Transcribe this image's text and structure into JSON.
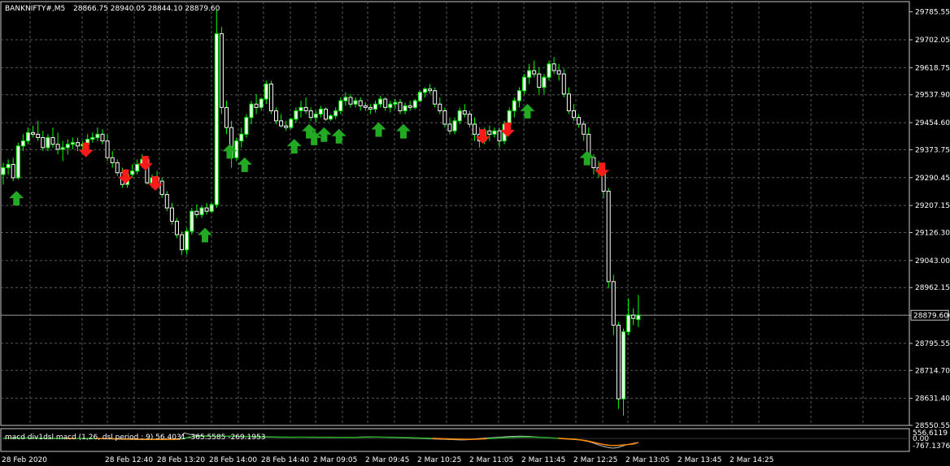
{
  "header": {
    "symbol": "BANKNIFTY#,M5",
    "ohlc": "28866.75 28940.05 28844.10 28879.60"
  },
  "current_price_label": "28879.60",
  "indicator": {
    "label": "macd div1dsl macd (1,26, dsl period ; 9) 56.4031 -365.5585 -269.1953",
    "axis_labels": [
      "556.6119",
      "0.00",
      "-767.1376"
    ]
  },
  "colors": {
    "background": "#000000",
    "bull_candle": "#ffffff",
    "candle_outline": "#00ff00",
    "up_arrow": "#22aa22",
    "down_arrow": "#ff1a1a",
    "grid": "#5a5a5a",
    "text": "#ffffff",
    "macd_line": "#c0c0c0",
    "macd_pos": "#22aa22",
    "macd_neg": "#ff8c00"
  },
  "chart_data": {
    "type": "candlestick",
    "ylim": [
      28550.55,
      29816.0
    ],
    "y_ticks": [
      "29785.55",
      "29702.05",
      "29618.75",
      "29537.90",
      "29454.60",
      "29373.75",
      "29290.45",
      "29207.15",
      "29126.30",
      "29043.00",
      "28962.15",
      "28879.60",
      "28795.55",
      "28714.70",
      "28631.40",
      "28550.55"
    ],
    "x_ticks": [
      "28 Feb 2020",
      "28 Feb 12:40",
      "28 Feb 13:20",
      "28 Feb 14:00",
      "28 Feb 14:40",
      "2 Mar 09:05",
      "2 Mar 09:45",
      "2 Mar 10:25",
      "2 Mar 11:05",
      "2 Mar 11:45",
      "2 Mar 12:25",
      "2 Mar 13:05",
      "2 Mar 13:45",
      "2 Mar 14:25"
    ],
    "current_price": 28879.6,
    "candles": [
      [
        29300,
        29335,
        29270,
        29320
      ],
      [
        29320,
        29345,
        29300,
        29330
      ],
      [
        29330,
        29350,
        29280,
        29290
      ],
      [
        29290,
        29395,
        29285,
        29385
      ],
      [
        29385,
        29420,
        29370,
        29400
      ],
      [
        29400,
        29440,
        29390,
        29425
      ],
      [
        29425,
        29445,
        29410,
        29420
      ],
      [
        29420,
        29460,
        29400,
        29410
      ],
      [
        29410,
        29430,
        29370,
        29380
      ],
      [
        29380,
        29420,
        29370,
        29410
      ],
      [
        29410,
        29440,
        29380,
        29390
      ],
      [
        29390,
        29425,
        29360,
        29375
      ],
      [
        29375,
        29400,
        29340,
        29380
      ],
      [
        29380,
        29405,
        29360,
        29390
      ],
      [
        29390,
        29410,
        29375,
        29395
      ],
      [
        29395,
        29410,
        29370,
        29385
      ],
      [
        29385,
        29400,
        29370,
        29390
      ],
      [
        29390,
        29420,
        29380,
        29405
      ],
      [
        29405,
        29425,
        29395,
        29410
      ],
      [
        29410,
        29440,
        29400,
        29420
      ],
      [
        29420,
        29435,
        29390,
        29400
      ],
      [
        29400,
        29420,
        29340,
        29350
      ],
      [
        29350,
        29370,
        29320,
        29335
      ],
      [
        29335,
        29345,
        29295,
        29305
      ],
      [
        29305,
        29320,
        29260,
        29270
      ],
      [
        29270,
        29310,
        29260,
        29300
      ],
      [
        29300,
        29330,
        29290,
        29310
      ],
      [
        29310,
        29345,
        29300,
        29330
      ],
      [
        29330,
        29360,
        29320,
        29345
      ],
      [
        29345,
        29355,
        29270,
        29275
      ],
      [
        29275,
        29300,
        29260,
        29290
      ],
      [
        29290,
        29310,
        29270,
        29280
      ],
      [
        29280,
        29290,
        29230,
        29240
      ],
      [
        29240,
        29250,
        29190,
        29200
      ],
      [
        29200,
        29215,
        29150,
        29160
      ],
      [
        29160,
        29170,
        29110,
        29120
      ],
      [
        29120,
        29130,
        29060,
        29075
      ],
      [
        29075,
        29140,
        29060,
        29130
      ],
      [
        29130,
        29200,
        29120,
        29190
      ],
      [
        29190,
        29210,
        29170,
        29180
      ],
      [
        29180,
        29205,
        29170,
        29200
      ],
      [
        29200,
        29215,
        29180,
        29190
      ],
      [
        29190,
        29215,
        29185,
        29210
      ],
      [
        29210,
        29790,
        29200,
        29720
      ],
      [
        29720,
        29740,
        29480,
        29500
      ],
      [
        29500,
        29520,
        29420,
        29440
      ],
      [
        29440,
        29460,
        29320,
        29350
      ],
      [
        29350,
        29410,
        29340,
        29400
      ],
      [
        29400,
        29440,
        29380,
        29420
      ],
      [
        29420,
        29480,
        29410,
        29470
      ],
      [
        29470,
        29520,
        29450,
        29510
      ],
      [
        29510,
        29540,
        29480,
        29500
      ],
      [
        29500,
        29530,
        29490,
        29525
      ],
      [
        29525,
        29580,
        29510,
        29570
      ],
      [
        29570,
        29580,
        29480,
        29490
      ],
      [
        29490,
        29500,
        29450,
        29460
      ],
      [
        29460,
        29480,
        29440,
        29445
      ],
      [
        29445,
        29460,
        29430,
        29440
      ],
      [
        29440,
        29470,
        29435,
        29465
      ],
      [
        29465,
        29500,
        29455,
        29490
      ],
      [
        29490,
        29520,
        29470,
        29500
      ],
      [
        29500,
        29530,
        29480,
        29490
      ],
      [
        29490,
        29500,
        29460,
        29470
      ],
      [
        29470,
        29490,
        29455,
        29480
      ],
      [
        29480,
        29505,
        29470,
        29495
      ],
      [
        29495,
        29500,
        29460,
        29465
      ],
      [
        29465,
        29480,
        29460,
        29475
      ],
      [
        29475,
        29500,
        29465,
        29490
      ],
      [
        29490,
        29530,
        29480,
        29520
      ],
      [
        29520,
        29545,
        29505,
        29530
      ],
      [
        29530,
        29540,
        29500,
        29510
      ],
      [
        29510,
        29530,
        29500,
        29520
      ],
      [
        29520,
        29530,
        29490,
        29505
      ],
      [
        29505,
        29515,
        29490,
        29500
      ],
      [
        29500,
        29510,
        29480,
        29495
      ],
      [
        29495,
        29520,
        29485,
        29510
      ],
      [
        29510,
        29535,
        29500,
        29525
      ],
      [
        29525,
        29530,
        29490,
        29500
      ],
      [
        29500,
        29520,
        29485,
        29510
      ],
      [
        29510,
        29525,
        29495,
        29515
      ],
      [
        29515,
        29525,
        29480,
        29490
      ],
      [
        29490,
        29515,
        29480,
        29505
      ],
      [
        29505,
        29520,
        29490,
        29500
      ],
      [
        29500,
        29525,
        29495,
        29520
      ],
      [
        29520,
        29550,
        29515,
        29545
      ],
      [
        29545,
        29560,
        29530,
        29555
      ],
      [
        29555,
        29570,
        29540,
        29550
      ],
      [
        29550,
        29560,
        29500,
        29510
      ],
      [
        29510,
        29530,
        29480,
        29490
      ],
      [
        29490,
        29500,
        29440,
        29450
      ],
      [
        29450,
        29470,
        29420,
        29430
      ],
      [
        29430,
        29470,
        29420,
        29460
      ],
      [
        29460,
        29500,
        29450,
        29490
      ],
      [
        29490,
        29510,
        29470,
        29480
      ],
      [
        29480,
        29490,
        29440,
        29450
      ],
      [
        29450,
        29470,
        29400,
        29420
      ],
      [
        29420,
        29440,
        29380,
        29400
      ],
      [
        29400,
        29440,
        29390,
        29430
      ],
      [
        29430,
        29445,
        29400,
        29420
      ],
      [
        29420,
        29440,
        29410,
        29430
      ],
      [
        29430,
        29440,
        29380,
        29400
      ],
      [
        29400,
        29460,
        29390,
        29450
      ],
      [
        29450,
        29500,
        29440,
        29490
      ],
      [
        29490,
        29530,
        29470,
        29520
      ],
      [
        29520,
        29560,
        29500,
        29550
      ],
      [
        29550,
        29600,
        29540,
        29590
      ],
      [
        29590,
        29630,
        29570,
        29610
      ],
      [
        29610,
        29640,
        29590,
        29600
      ],
      [
        29600,
        29620,
        29540,
        29560
      ],
      [
        29560,
        29600,
        29540,
        29590
      ],
      [
        29590,
        29640,
        29580,
        29630
      ],
      [
        29630,
        29650,
        29600,
        29610
      ],
      [
        29610,
        29630,
        29580,
        29600
      ],
      [
        29600,
        29615,
        29530,
        29540
      ],
      [
        29540,
        29560,
        29480,
        29490
      ],
      [
        29490,
        29510,
        29460,
        29470
      ],
      [
        29470,
        29480,
        29440,
        29450
      ],
      [
        29450,
        29460,
        29400,
        29420
      ],
      [
        29420,
        29440,
        29330,
        29350
      ],
      [
        29350,
        29360,
        29300,
        29320
      ],
      [
        29320,
        29340,
        29290,
        29310
      ],
      [
        29310,
        29320,
        29230,
        29250
      ],
      [
        29250,
        29260,
        28960,
        28980
      ],
      [
        28980,
        29000,
        28820,
        28850
      ],
      [
        28850,
        28860,
        28600,
        28630
      ],
      [
        28630,
        28840,
        28580,
        28830
      ],
      [
        28830,
        28930,
        28820,
        28880
      ],
      [
        28880,
        28900,
        28850,
        28870
      ],
      [
        28866.75,
        28940.05,
        28844.1,
        28879.6
      ]
    ],
    "up_signals": [
      2,
      40,
      45,
      48,
      58,
      61,
      62,
      64,
      67,
      75,
      80,
      105,
      117,
      130,
      134
    ],
    "down_signals": [
      16,
      24,
      28,
      30,
      96,
      101,
      120,
      129,
      148
    ],
    "macd": {
      "ylim": [
        -767.1376,
        556.6119
      ],
      "values": [
        20,
        30,
        35,
        40,
        42,
        38,
        30,
        22,
        15,
        10,
        5,
        0,
        -5,
        -10,
        -12,
        -8,
        -4,
        0,
        5,
        8,
        6,
        2,
        -5,
        -12,
        -20,
        -28,
        -36,
        -44,
        -50,
        -56,
        -60,
        -64,
        -68,
        -72,
        -76,
        -80,
        -78,
        -70,
        -60,
        -50,
        -40,
        -30,
        -20,
        380,
        300,
        250,
        210,
        190,
        180,
        170,
        165,
        160,
        158,
        156,
        150,
        140,
        130,
        120,
        112,
        108,
        105,
        100,
        95,
        90,
        86,
        82,
        80,
        78,
        80,
        84,
        88,
        90,
        88,
        84,
        80,
        76,
        74,
        72,
        70,
        70,
        72,
        74,
        76,
        80,
        90,
        100,
        110,
        115,
        110,
        100,
        90,
        80,
        70,
        60,
        50,
        40,
        30,
        20,
        10,
        0,
        -10,
        -20,
        -30,
        -40,
        -50,
        -60,
        -70,
        -80,
        -90,
        -100,
        -90,
        -70,
        -40,
        -10,
        10,
        30,
        50,
        70,
        90,
        110,
        130,
        140,
        150,
        155,
        150,
        140,
        120,
        100,
        80,
        60,
        40,
        20,
        0,
        -20,
        -40,
        -60,
        -80,
        -100,
        -150,
        -200,
        -280,
        -380,
        -480,
        -560,
        -620,
        -660,
        -620,
        -540,
        -440,
        -380,
        -320,
        -280
      ],
      "signal": [
        15,
        22,
        28,
        33,
        36,
        36,
        34,
        30,
        26,
        21,
        17,
        13,
        9,
        5,
        2,
        0,
        -1,
        -1,
        0,
        2,
        3,
        3,
        1,
        -2,
        -6,
        -11,
        -16,
        -22,
        -28,
        -34,
        -39,
        -44,
        -49,
        -54,
        -58,
        -63,
        -66,
        -67,
        -66,
        -63,
        -59,
        -54,
        -48,
        20,
        76,
        110,
        130,
        142,
        150,
        154,
        156,
        157,
        157,
        157,
        156,
        153,
        148,
        143,
        137,
        131,
        126,
        121,
        116,
        111,
        106,
        101,
        97,
        93,
        90,
        89,
        88,
        88,
        88,
        87,
        86,
        84,
        82,
        80,
        78,
        76,
        75,
        74,
        74,
        74,
        76,
        80,
        85,
        90,
        93,
        94,
        93,
        90,
        85,
        79,
        73,
        66,
        58,
        51,
        43,
        35,
        26,
        17,
        8,
        -2,
        -12,
        -22,
        -32,
        -42,
        -52,
        -60,
        -64,
        -61,
        -53,
        -41,
        -28,
        -14,
        0,
        15,
        31,
        46,
        61,
        73,
        84,
        92,
        97,
        96,
        92,
        83,
        72,
        59,
        44,
        28,
        12,
        -4,
        -20,
        -38,
        -60,
        -88,
        -125,
        -176,
        -237,
        -301,
        -365,
        -424,
        -463,
        -477,
        -470,
        -452,
        -426,
        -397,
        -365,
        -269
      ]
    }
  }
}
